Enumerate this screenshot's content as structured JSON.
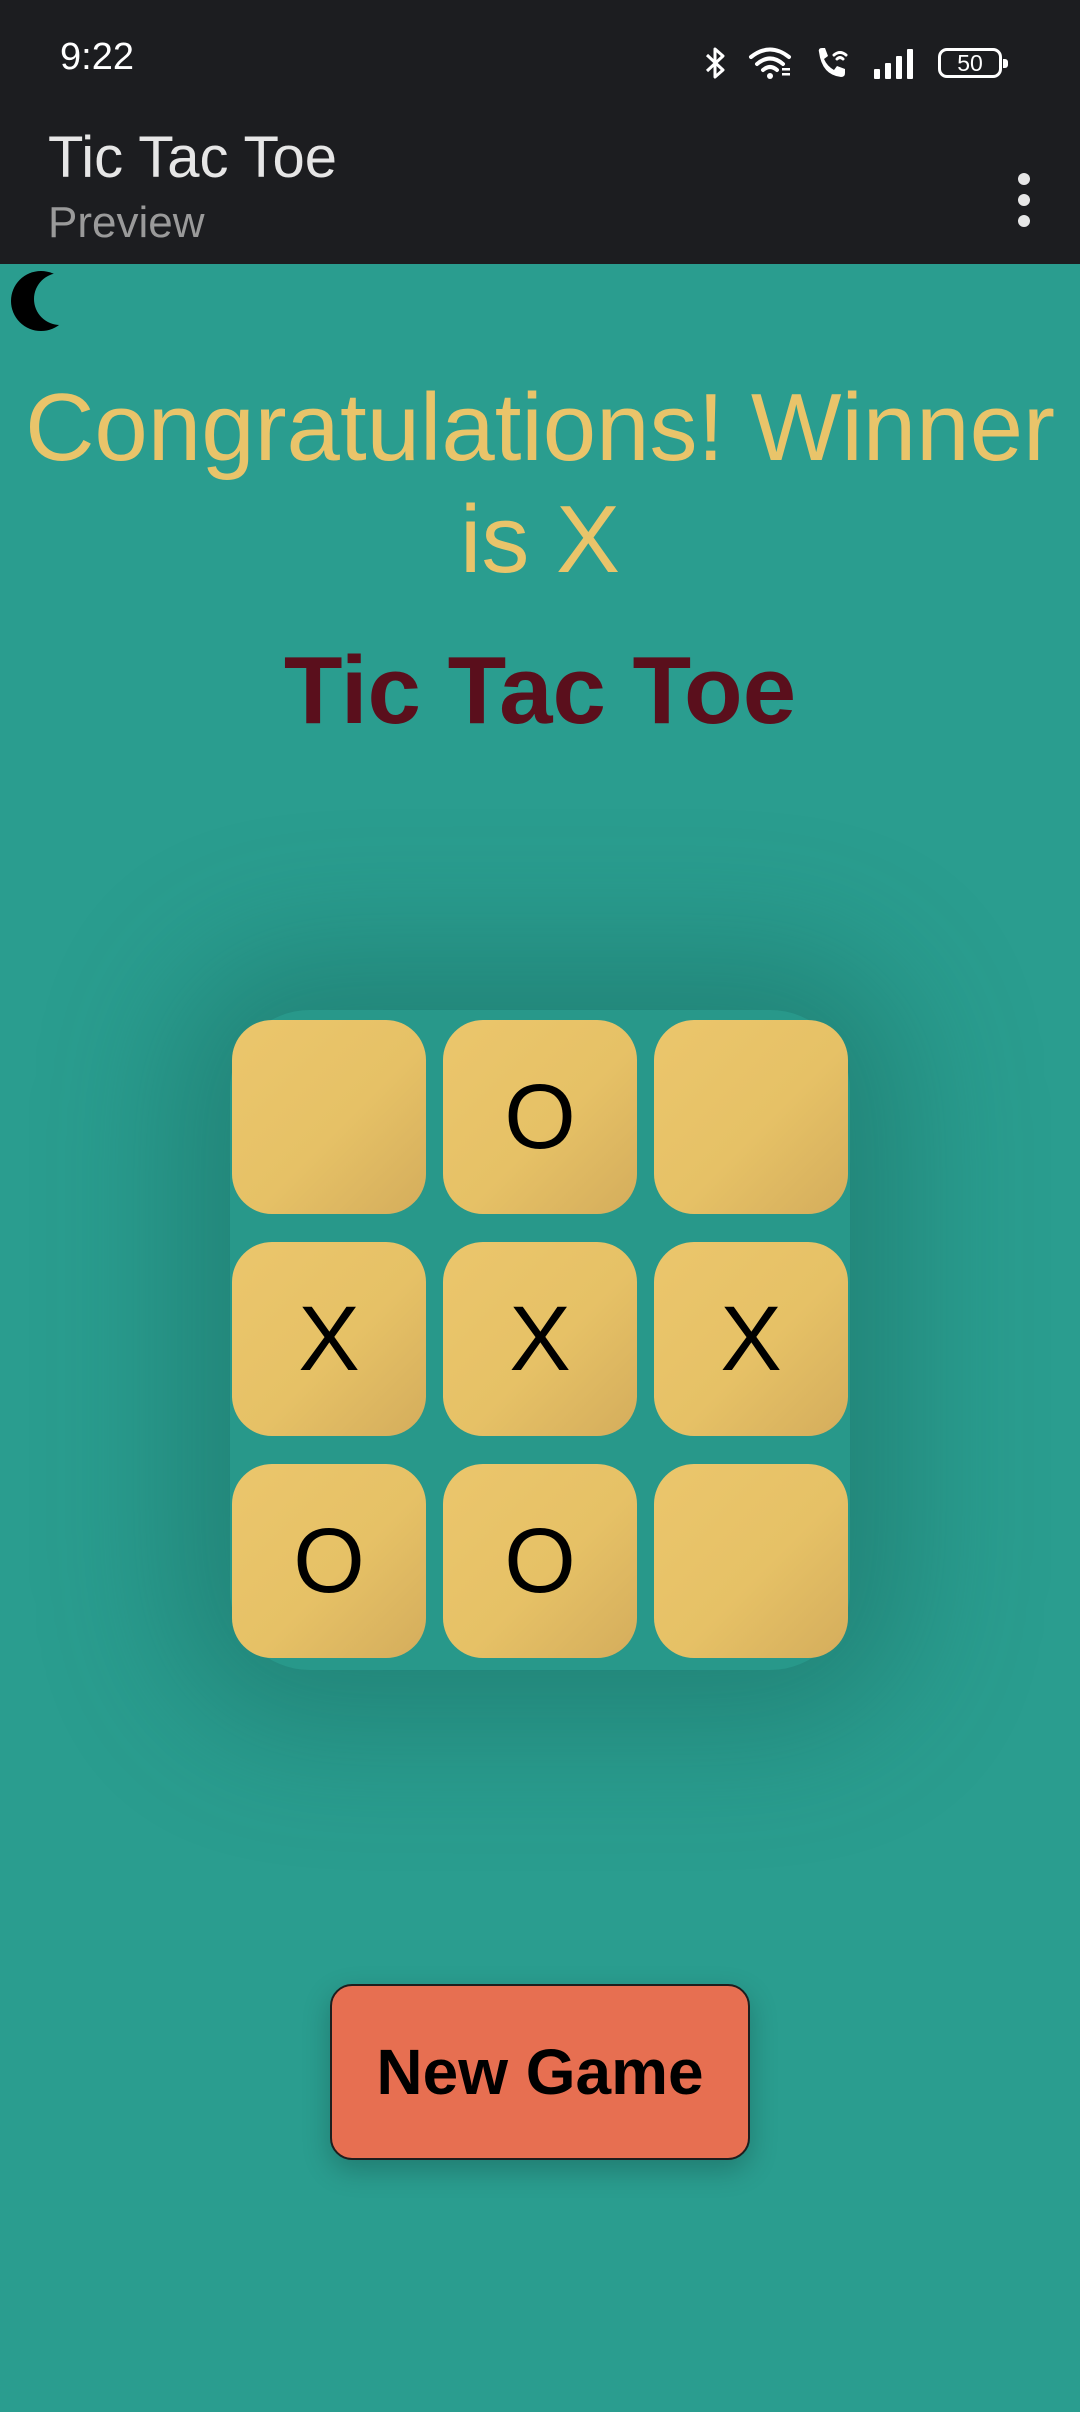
{
  "status_bar": {
    "time": "9:22",
    "battery_level": "50",
    "icons": [
      "bluetooth-icon",
      "wifi-icon",
      "wifi-calling-icon",
      "signal-icon",
      "battery-icon"
    ]
  },
  "app_bar": {
    "title": "Tic Tac Toe",
    "subtitle": "Preview",
    "menu_icon": "overflow-menu-icon"
  },
  "theme_toggle": {
    "icon": "moon-icon"
  },
  "game": {
    "winner_message": "Congratulations! Winner is X",
    "title": "Tic Tac Toe",
    "board": [
      "",
      "O",
      "",
      "X",
      "X",
      "X",
      "O",
      "O",
      ""
    ],
    "new_game_label": "New Game"
  },
  "colors": {
    "background": "#2a9d8f",
    "app_bar": "#1c1d20",
    "winner_text": "#e9c46a",
    "title_text": "#5a0f1c",
    "cell": "#e9c46a",
    "new_game_button": "#e76f51"
  }
}
